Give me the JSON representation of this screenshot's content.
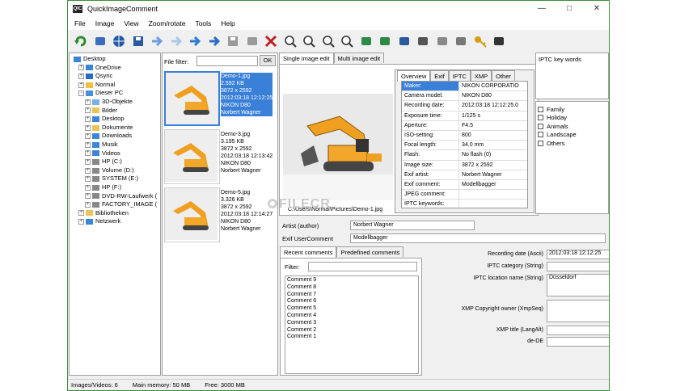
{
  "window": {
    "title": "QuickImageComment",
    "app_icon_text": "QIC"
  },
  "menu": [
    "File",
    "Image",
    "View",
    "Zoom/rotate",
    "Tools",
    "Help"
  ],
  "toolbar_icons": [
    "refresh-icon",
    "abc-icon",
    "globe-icon",
    "save-icon",
    "back-arrow-icon",
    "circle-arrow-icon",
    "forward-arrow-icon",
    "next-arrow-icon",
    "save-copy-icon",
    "undo-icon",
    "delete-x-icon",
    "zoom-fit-icon",
    "zoom-in-icon",
    "zoom-out-icon",
    "zoom-100-icon",
    "rotate-left-icon",
    "rotate-right-icon",
    "tools-icon",
    "wrench-icon",
    "tag-icon",
    "edit-icon",
    "key-icon",
    "binoculars-icon"
  ],
  "tree": [
    {
      "label": "Desktop",
      "depth": 0,
      "exp": "",
      "icon": "#3b84d6"
    },
    {
      "label": "OneDrive",
      "depth": 1,
      "exp": "+",
      "icon": "#3b84d6"
    },
    {
      "label": "Qsync",
      "depth": 1,
      "exp": "+",
      "icon": "#2a6cc4"
    },
    {
      "label": "Normal",
      "depth": 1,
      "exp": "+",
      "icon": "#f0c040"
    },
    {
      "label": "Dieser PC",
      "depth": 1,
      "exp": "-",
      "icon": "#4a90d9"
    },
    {
      "label": "3D-Objekte",
      "depth": 2,
      "exp": "+",
      "icon": "#79b0e6"
    },
    {
      "label": "Bilder",
      "depth": 2,
      "exp": "+",
      "icon": "#e8c55a"
    },
    {
      "label": "Desktop",
      "depth": 2,
      "exp": "+",
      "icon": "#3b84d6"
    },
    {
      "label": "Dokumente",
      "depth": 2,
      "exp": "+",
      "icon": "#e8c55a"
    },
    {
      "label": "Downloads",
      "depth": 2,
      "exp": "+",
      "icon": "#3b84d6"
    },
    {
      "label": "Musik",
      "depth": 2,
      "exp": "+",
      "icon": "#3b84d6"
    },
    {
      "label": "Videos",
      "depth": 2,
      "exp": "+",
      "icon": "#3b84d6"
    },
    {
      "label": "HP (C:)",
      "depth": 2,
      "exp": "+",
      "icon": "#888888"
    },
    {
      "label": "Volume (D:)",
      "depth": 2,
      "exp": "+",
      "icon": "#888888"
    },
    {
      "label": "SYSTEM (E:)",
      "depth": 2,
      "exp": "+",
      "icon": "#888888"
    },
    {
      "label": "HP (F:)",
      "depth": 2,
      "exp": "+",
      "icon": "#888888"
    },
    {
      "label": "DVD-RW-Laufwerk (",
      "depth": 2,
      "exp": "+",
      "icon": "#888888"
    },
    {
      "label": "FACTORY_IMAGE (",
      "depth": 2,
      "exp": "+",
      "icon": "#888888"
    },
    {
      "label": "Bibliotheken",
      "depth": 1,
      "exp": "+",
      "icon": "#e8c55a"
    },
    {
      "label": "Netzwerk",
      "depth": 1,
      "exp": "+",
      "icon": "#3b84d6"
    }
  ],
  "file_filter": {
    "label": "File filter:",
    "value": "",
    "ok": "OK"
  },
  "thumbnails": [
    {
      "lines": [
        "Demo-1.jpg",
        "2.592 KB",
        "3872 x 2592",
        "2012:03:18 12:12:25",
        "NIKON D80",
        "Norbert Wagner"
      ],
      "selected": true
    },
    {
      "lines": [
        "Demo-3.jpg",
        "3.195 KB",
        "3872 x 2592",
        "2012:03:18 12:13:42",
        "NIKON D80",
        "Norbert Wagner"
      ],
      "selected": false
    },
    {
      "lines": [
        "Demo-5.jpg",
        "3.326 KB",
        "3872 x 2592",
        "2012:03:18 12:14:27",
        "NIKON D80",
        "Norbert Wagner"
      ],
      "selected": false
    }
  ],
  "edit_tabs": [
    "Single image edit",
    "Multi image edit"
  ],
  "meta_tabs": [
    "Overview",
    "Exif",
    "IPTC",
    "XMP",
    "Other"
  ],
  "overview": [
    {
      "k": "Maker:",
      "v": "NIKON CORPORATIO"
    },
    {
      "k": "Camera model:",
      "v": "NIKON D80"
    },
    {
      "k": "Recording date:",
      "v": "2012:03:18 12:12:25.0"
    },
    {
      "k": "Exposure time:",
      "v": "1/125 s"
    },
    {
      "k": "Aperture:",
      "v": "F4.5"
    },
    {
      "k": "ISO-setting:",
      "v": "800"
    },
    {
      "k": "Focal length:",
      "v": "34.0 mm"
    },
    {
      "k": "Flash:",
      "v": "No flash (0)"
    },
    {
      "k": "Image size:",
      "v": "3872 x 2592"
    },
    {
      "k": "Exif artist:",
      "v": "Norbert Wagner"
    },
    {
      "k": "Exif comment:",
      "v": "Modellbagger"
    },
    {
      "k": "JPEG comment:",
      "v": ""
    },
    {
      "k": "IPTC keywords:",
      "v": ""
    }
  ],
  "image_path": "C:\\Users\\Normal\\Pictures\\Demo-1.jpg",
  "artist": {
    "label": "Artist (author)",
    "value": "Norbert Wagner"
  },
  "usercomment": {
    "label": "Exif UserComment",
    "value": "Modellbagger"
  },
  "iptc_keywords": {
    "label": "IPTC key words"
  },
  "keywords": [
    "Family",
    "Holiday",
    "Animals",
    "Landscape",
    "Others"
  ],
  "comment_tabs": [
    "Recent comments",
    "Predefined comments"
  ],
  "comment_filter": {
    "label": "Filter:",
    "value": ""
  },
  "recent_comments": [
    "Comment 9",
    "Comment 8",
    "Comment 7",
    "Comment 6",
    "Comment 5",
    "Comment 4",
    "Comment 3",
    "Comment 2",
    "Comment 1"
  ],
  "props": [
    {
      "label": "Recording date (Ascii)",
      "value": "2012:03:18 12:12:25"
    },
    {
      "label": "IPTC category (String)",
      "value": ""
    },
    {
      "label": "IPTC location name (String)",
      "value": "Düsseldorf"
    },
    {
      "label": "XMP Copyright owner (XmpSeq)",
      "value": ""
    },
    {
      "label": "XMP title (LangAlt)",
      "value": ""
    },
    {
      "label": "de-DE",
      "value": ""
    }
  ],
  "status": {
    "images": "Images/Videos: 6",
    "memory": "Main memory: 50 MB",
    "free": "Free: 3000 MB"
  },
  "watermark": "FILECR"
}
